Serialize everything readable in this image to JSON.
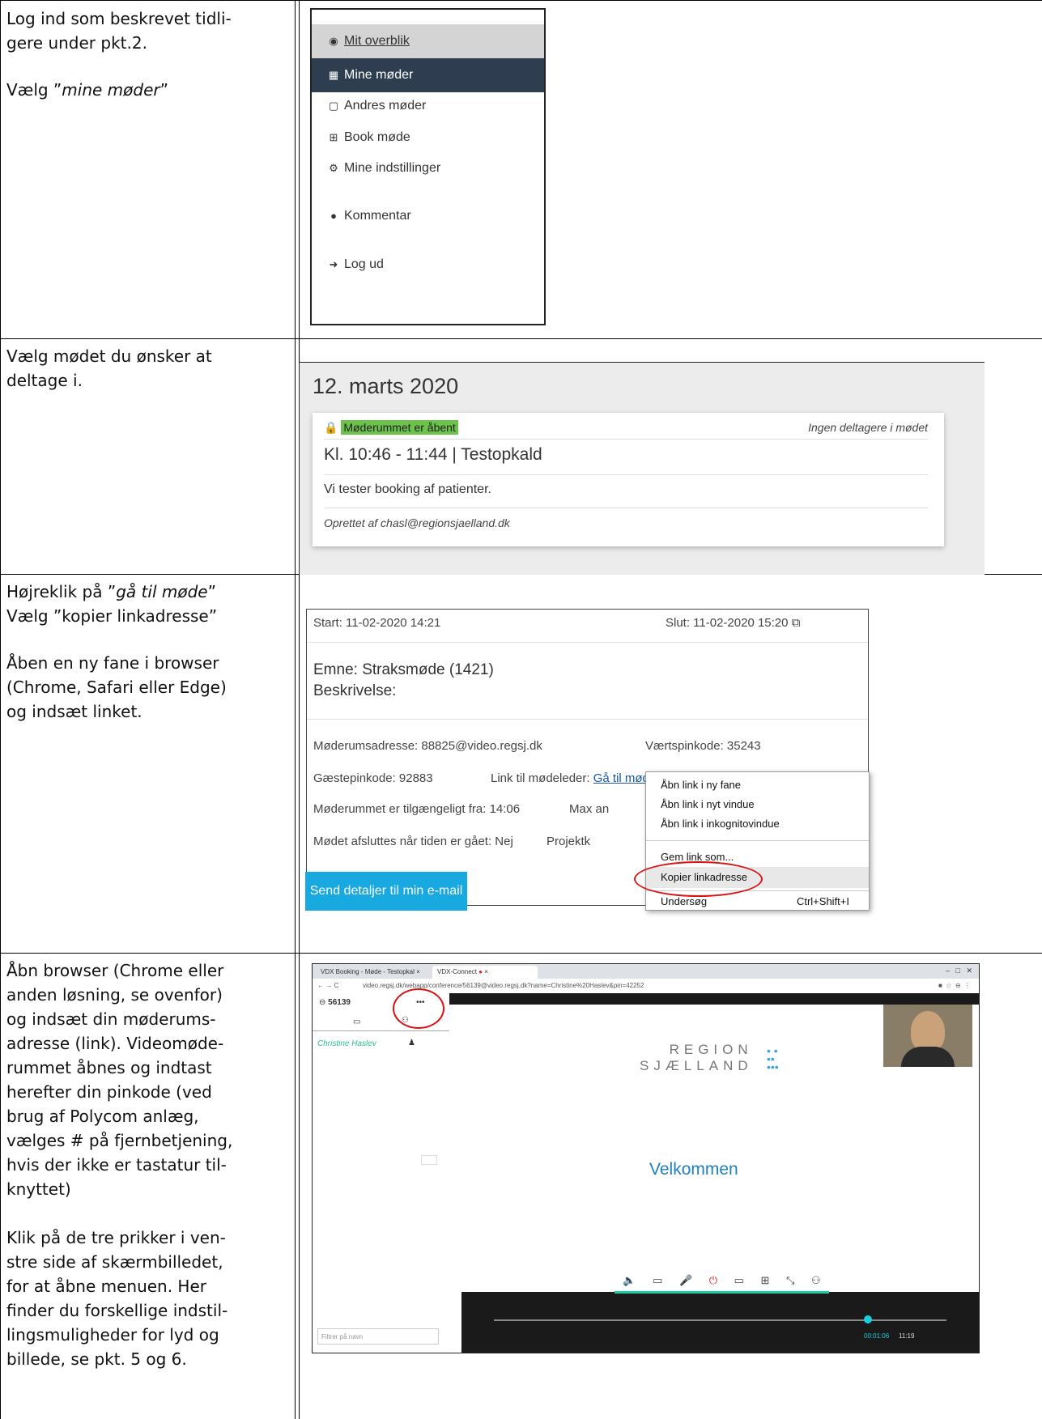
{
  "rows": [
    {
      "text_lines": [
        "Log ind som beskrevet tidli-",
        "gere under pkt.2."
      ],
      "text_lines2_pre": "Vælg ”",
      "text_lines2_em": "mine møder",
      "text_lines2_post": "”"
    },
    {
      "text_lines": [
        "Vælg mødet du ønsker at",
        "deltage i."
      ]
    },
    {
      "line1_pre": "Højreklik på ”",
      "line1_em": "gå til møde",
      "line1_post": "”",
      "line2": "Vælg ”kopier linkadresse”",
      "para2": [
        "Åben en ny fane i browser",
        "(Chrome, Safari eller Edge)",
        "og indsæt linket."
      ]
    },
    {
      "para1": [
        "Åbn browser (Chrome eller",
        "anden løsning, se ovenfor)",
        "og indsæt din møderums-",
        "adresse (link). Videomøde-",
        "rummet åbnes og indtast",
        "herefter din pinkode (ved",
        "brug af Polycom anlæg,",
        "vælges # på fjernbetjening,",
        "hvis der ikke er tastatur til-",
        "knyttet)"
      ],
      "para2": [
        "Klik på de tre prikker i ven-",
        "stre side af skærmbilledet,",
        "for at åbne menuen. Her",
        "finder du forskellige indstil-",
        "lingsmuligheder for lyd og",
        "billede, se pkt. 5 og 6."
      ]
    }
  ],
  "menu": {
    "items": [
      {
        "label": "Mit overblik",
        "icon": "dashboard-icon"
      },
      {
        "label": "Mine møder",
        "icon": "calendar-icon"
      },
      {
        "label": "Andres møder",
        "icon": "calendar-empty-icon"
      },
      {
        "label": "Book møde",
        "icon": "calendar-plus-icon"
      },
      {
        "label": "Mine indstillinger",
        "icon": "gears-icon"
      },
      {
        "label": "Kommentar",
        "icon": "comment-icon"
      },
      {
        "label": "Log ud",
        "icon": "sign-out-icon"
      }
    ]
  },
  "meeting": {
    "date": "12. marts 2020",
    "status": "Møderummet er åbent",
    "participants": "Ingen deltagere i mødet",
    "title": "Kl. 10:46 - 11:44 | Testopkald",
    "description": "Vi tester booking af patienter.",
    "author": "Oprettet af chasl@regionsjaelland.dk"
  },
  "details": {
    "start": "Start: 11-02-2020 14:21",
    "end": "Slut: 11-02-2020 15:20",
    "subject": "Emne: Straksmøde (1421)",
    "description": "Beskrivelse:",
    "room_address": "Møderumsadresse: 88825@video.regsj.dk",
    "host_pin": "Værtspinkode: 35243",
    "guest_pin": "Gæstepinkode: 92883",
    "host_link_label": "Link til mødeleder: ",
    "host_link": "Gå til møde",
    "available_from": "Møderummet er tilgængeligt fra: 14:06",
    "max_label": "Max an",
    "ends_when": "Mødet afsluttes når tiden er gået: Nej",
    "project_label": "Projektk",
    "send_button": "Send detaljer til min e-mail"
  },
  "context_menu": {
    "items": [
      "Åbn link i ny fane",
      "Åbn link i nyt vindue",
      "Åbn link i inkognitovindue",
      "Gem link som...",
      "Kopier linkadresse",
      "Undersøg"
    ],
    "shortcut": "Ctrl+Shift+I"
  },
  "browser": {
    "tab1": "VDX Booking - Møde - Testopkal",
    "tab2": "VDX-Connect",
    "url": "video.regsj.dk/webapp/conference/56139@video.regsj.dk?name=Christine%20Haslev&pin=42252",
    "room_number": "56139",
    "participant": "Christine Haslev",
    "filter_placeholder": "Filtrer på navn",
    "logo_line1": "REGION",
    "logo_line2": "SJÆLLAND",
    "welcome": "Velkommen",
    "time_elapsed": "00:01:06",
    "time_clock": "11:19",
    "dots": "•••"
  }
}
